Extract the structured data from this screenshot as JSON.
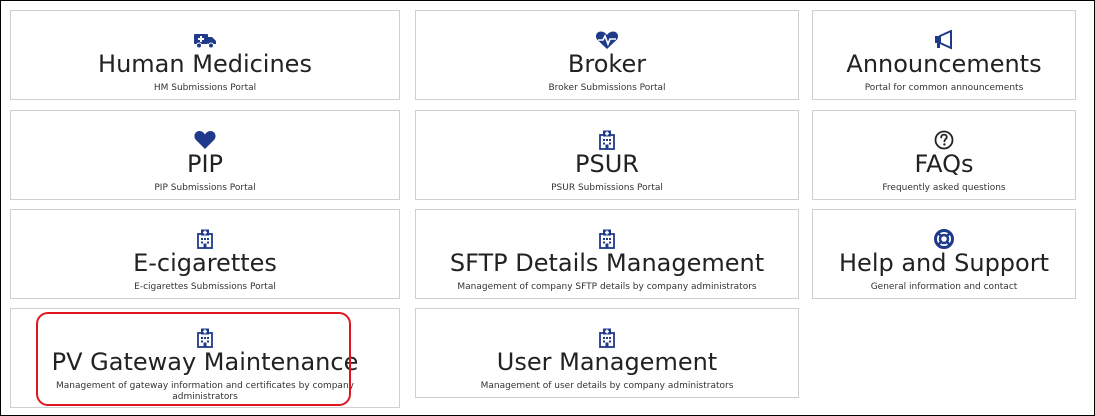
{
  "tiles": [
    {
      "title": "Human Medicines",
      "subtitle": "HM Submissions Portal",
      "icon": "ambulance-icon"
    },
    {
      "title": "Broker",
      "subtitle": "Broker Submissions Portal",
      "icon": "heartbeat-icon"
    },
    {
      "title": "Announcements",
      "subtitle": "Portal for common announcements",
      "icon": "megaphone-icon"
    },
    {
      "title": "PIP",
      "subtitle": "PIP Submissions Portal",
      "icon": "heart-icon"
    },
    {
      "title": "PSUR",
      "subtitle": "PSUR Submissions Portal",
      "icon": "hospital-icon"
    },
    {
      "title": "FAQs",
      "subtitle": "Frequently asked questions",
      "icon": "question-circle-icon"
    },
    {
      "title": "E-cigarettes",
      "subtitle": "E-cigarettes Submissions Portal",
      "icon": "hospital-icon"
    },
    {
      "title": "SFTP Details Management",
      "subtitle": "Management of company SFTP details by company administrators",
      "icon": "hospital-icon"
    },
    {
      "title": "Help and Support",
      "subtitle": "General information and contact",
      "icon": "life-ring-icon"
    },
    {
      "title": "PV Gateway Maintenance",
      "subtitle": "Management of gateway information and certificates by company administrators",
      "icon": "hospital-icon"
    },
    {
      "title": "User Management",
      "subtitle": "Management of user details by company administrators",
      "icon": "hospital-icon"
    }
  ],
  "colors": {
    "icon": "#1f3a8a",
    "tile_border": "#cfcfcf",
    "highlight": "#e0161f"
  }
}
